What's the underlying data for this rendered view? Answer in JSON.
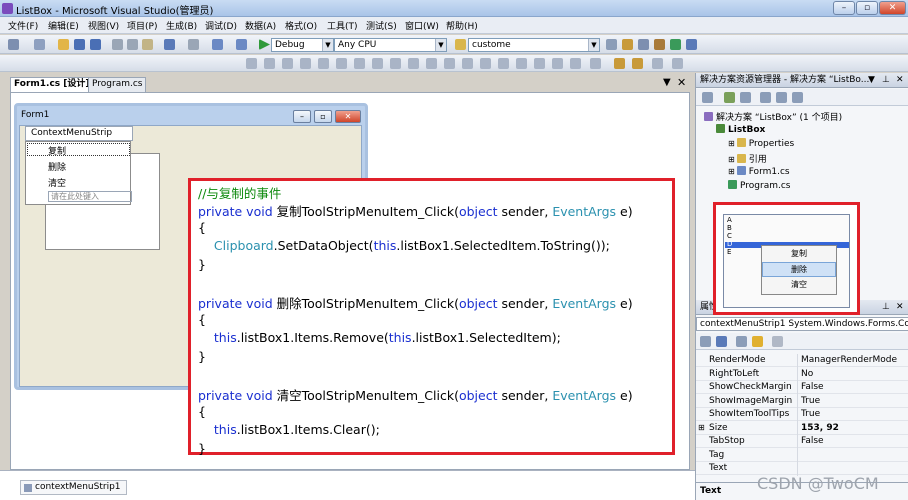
{
  "window": {
    "title": "ListBox - Microsoft Visual Studio(管理员)"
  },
  "menu": [
    "文件(F)",
    "编辑(E)",
    "视图(V)",
    "项目(P)",
    "生成(B)",
    "调试(D)",
    "数据(A)",
    "格式(O)",
    "工具(T)",
    "测试(S)",
    "窗口(W)",
    "帮助(H)"
  ],
  "toolbar": {
    "config": "Debug",
    "platform": "Any CPU",
    "find": "custome"
  },
  "tabs": [
    "Form1.cs [设计]*",
    "Program.cs"
  ],
  "designer": {
    "form_title": "Form1",
    "cms_label": "ContextMenuStrip",
    "cms_items": [
      "复制",
      "删除",
      "清空"
    ],
    "type_here": "请在此处键入"
  },
  "code": [
    {
      "t": "cm",
      "s": "//与复制的事件"
    },
    {
      "parts": [
        [
          "kw",
          "private "
        ],
        [
          "kw",
          "void "
        ],
        [
          "",
          "复制ToolStripMenuItem_Click("
        ],
        [
          "kw",
          "object "
        ],
        [
          "",
          "sender, "
        ],
        [
          "ty",
          "EventArgs "
        ],
        [
          "",
          "e)"
        ]
      ]
    },
    {
      "parts": [
        [
          "",
          "{"
        ]
      ]
    },
    {
      "parts": [
        [
          "",
          "    "
        ],
        [
          "ty",
          "Clipboard"
        ],
        [
          "",
          ".SetDataObject("
        ],
        [
          "kw",
          "this"
        ],
        [
          "",
          ".listBox1.SelectedItem.ToString());"
        ]
      ]
    },
    {
      "parts": [
        [
          "",
          "}"
        ]
      ]
    },
    {
      "parts": []
    },
    {
      "parts": [
        [
          "kw",
          "private "
        ],
        [
          "kw",
          "void "
        ],
        [
          "",
          "删除ToolStripMenuItem_Click("
        ],
        [
          "kw",
          "object "
        ],
        [
          "",
          "sender, "
        ],
        [
          "ty",
          "EventArgs "
        ],
        [
          "",
          "e)"
        ]
      ]
    },
    {
      "parts": [
        [
          "",
          "{"
        ]
      ]
    },
    {
      "parts": [
        [
          "",
          "    "
        ],
        [
          "kw",
          "this"
        ],
        [
          "",
          ".listBox1.Items.Remove("
        ],
        [
          "kw",
          "this"
        ],
        [
          "",
          ".listBox1.SelectedItem);"
        ]
      ]
    },
    {
      "parts": [
        [
          "",
          "}"
        ]
      ]
    },
    {
      "parts": []
    },
    {
      "parts": [
        [
          "kw",
          "private "
        ],
        [
          "kw",
          "void "
        ],
        [
          "",
          "清空ToolStripMenuItem_Click("
        ],
        [
          "kw",
          "object "
        ],
        [
          "",
          "sender, "
        ],
        [
          "ty",
          "EventArgs "
        ],
        [
          "",
          "e)"
        ]
      ]
    },
    {
      "parts": [
        [
          "",
          "{"
        ]
      ]
    },
    {
      "parts": [
        [
          "",
          "    "
        ],
        [
          "kw",
          "this"
        ],
        [
          "",
          ".listBox1.Items.Clear();"
        ]
      ]
    },
    {
      "parts": [
        [
          "",
          "}"
        ]
      ]
    }
  ],
  "tray": {
    "item": "contextMenuStrip1"
  },
  "solution": {
    "header": "解决方案资源管理器 - 解决方案 “ListBo...",
    "tree": [
      {
        "label": "解决方案 “ListBox” (1 个项目)",
        "level": 0,
        "bold": false,
        "icon": "solution"
      },
      {
        "label": "ListBox",
        "level": 1,
        "bold": true,
        "icon": "project"
      },
      {
        "label": "Properties",
        "level": 2,
        "bold": false,
        "icon": "folder"
      },
      {
        "label": "引用",
        "level": 2,
        "bold": false,
        "icon": "folder"
      },
      {
        "label": "Form1.cs",
        "level": 2,
        "bold": false,
        "icon": "form"
      },
      {
        "label": "Program.cs",
        "level": 2,
        "bold": false,
        "icon": "cs"
      }
    ]
  },
  "preview": {
    "letters": [
      "A",
      "B",
      "C",
      "D",
      "E"
    ],
    "menu": [
      "复制",
      "删除",
      "清空"
    ],
    "highlight": "删除"
  },
  "properties": {
    "header": "属性",
    "object": "contextMenuStrip1  System.Windows.Forms.Co",
    "rows": [
      {
        "k": "RenderMode",
        "v": "ManagerRenderMode"
      },
      {
        "k": "RightToLeft",
        "v": "No"
      },
      {
        "k": "ShowCheckMargin",
        "v": "False"
      },
      {
        "k": "ShowImageMargin",
        "v": "True"
      },
      {
        "k": "ShowItemToolTips",
        "v": "True"
      },
      {
        "k": "Size",
        "v": "153, 92",
        "bold": true
      },
      {
        "k": "TabStop",
        "v": "False"
      },
      {
        "k": "Tag",
        "v": ""
      },
      {
        "k": "Text",
        "v": ""
      }
    ],
    "desc_title": "Text"
  },
  "watermark": "CSDN @TwoCM"
}
